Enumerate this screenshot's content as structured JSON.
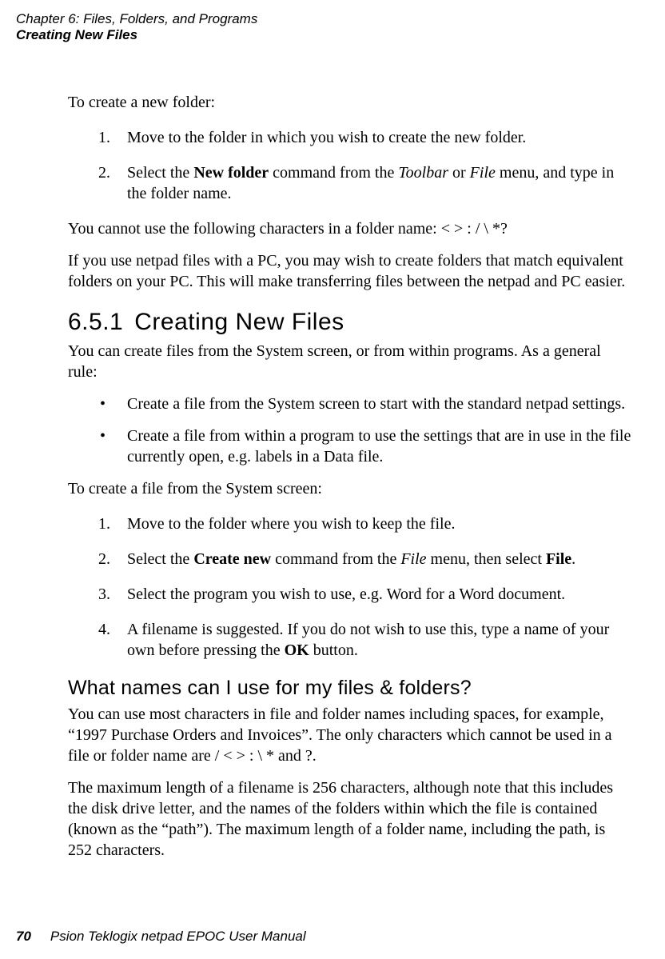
{
  "header": {
    "chapter": "Chapter 6:  Files, Folders, and Programs",
    "section": "Creating New Files"
  },
  "body": {
    "intro": "To create a new folder:",
    "steps_folder": [
      {
        "num": "1",
        "text": "Move to the folder in which you wish to create the new folder."
      },
      {
        "num": "2",
        "prefix": "Select the ",
        "bold1": "New folder",
        "mid1": " command from the ",
        "ital1": "Toolbar",
        "mid2": " or ",
        "ital2": "File",
        "suffix": " menu, and type in the folder name."
      }
    ],
    "no_chars": "You cannot use the following characters in a folder name: < > : / \\ *?",
    "pc_match": "If you use netpad files with a PC, you may wish to create folders that match equivalent folders on your PC. This will make transferring files between the netpad and PC easier.",
    "heading": {
      "num": "6.5.1",
      "title": "Creating New Files"
    },
    "create_intro": "You can create files from the System screen, or from within programs. As a general rule:",
    "bullets": [
      "Create a file from the System screen to start with the standard netpad settings.",
      "Create a file from within a program to use the settings that are in use in the file currently open, e.g. labels in a Data file."
    ],
    "create_file_intro": "To create a file from the System screen:",
    "steps_file": [
      {
        "num": "1",
        "text": "Move to the folder where you wish to keep the file."
      },
      {
        "num": "2",
        "prefix": "Select the ",
        "bold1": "Create new",
        "mid1": " command from the ",
        "ital1": "File",
        "mid2": " menu, then select ",
        "bold2": "File",
        "suffix": "."
      },
      {
        "num": "3",
        "text": "Select the program you wish to use, e.g. Word for a Word document."
      },
      {
        "num": "4",
        "prefix": "A filename is suggested. If you do not wish to use this, type a name of your own before pressing the ",
        "bold1": "OK",
        "suffix": " button."
      }
    ],
    "subheading": "What names can I use for my files & folders?",
    "names_p1": "You can use most characters in file and folder names including spaces, for example, “1997 Purchase Orders and Invoices”. The only characters which cannot be used in a file or folder name are / < > : \\ * and ?.",
    "names_p2": "The maximum length of a filename is 256 characters, although note that this includes the disk drive letter, and the names of the folders within which the file is contained (known as the “path”). The maximum length of a folder name, including the path, is 252 characters."
  },
  "footer": {
    "page": "70",
    "title": "Psion Teklogix netpad EPOC User Manual"
  }
}
